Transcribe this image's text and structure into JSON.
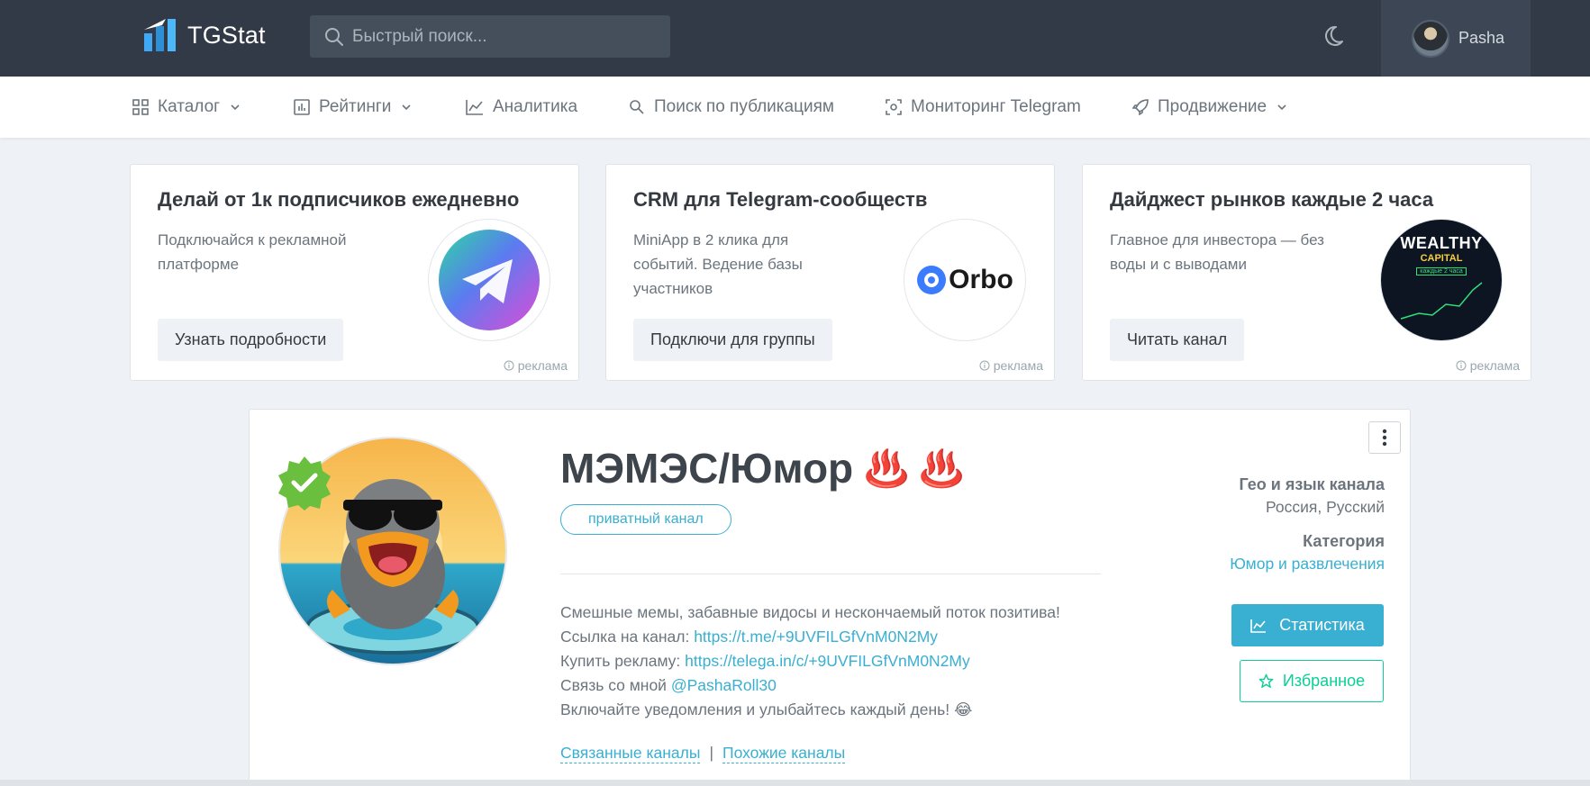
{
  "header": {
    "logo_text": "TGStat",
    "search_placeholder": "Быстрый поиск...",
    "user_name": "Pasha"
  },
  "nav": {
    "items": [
      {
        "label": "Каталог",
        "icon": "grid-icon",
        "dropdown": true
      },
      {
        "label": "Рейтинги",
        "icon": "bar-chart-icon",
        "dropdown": true
      },
      {
        "label": "Аналитика",
        "icon": "line-chart-icon",
        "dropdown": false
      },
      {
        "label": "Поиск по публикациям",
        "icon": "search-doc-icon",
        "dropdown": false
      },
      {
        "label": "Мониторинг Telegram",
        "icon": "scan-icon",
        "dropdown": false
      },
      {
        "label": "Продвижение",
        "icon": "rocket-icon",
        "dropdown": true
      }
    ]
  },
  "ads": [
    {
      "title": "Делай от 1к подписчиков ежедневно",
      "text": "Подключайся к рекламной платформе",
      "button": "Узнать подробности",
      "mark": "реклама",
      "logo": "telegram-logo"
    },
    {
      "title": "CRM для Telegram-сообществ",
      "text": "MiniApp в 2 клика для событий. Ведение базы участников",
      "button": "Подключи для группы",
      "mark": "реклама",
      "logo_text": "Orbo"
    },
    {
      "title": "Дайджест рынков каждые 2 часа",
      "text": "Главное для инвестора — без воды и с выводами",
      "button": "Читать канал",
      "mark": "реклама",
      "logo_text": "WEALTHY",
      "logo_sub": "CAPITAL",
      "logo_tag": "каждые 2 часа"
    }
  ],
  "channel": {
    "title": "МЭМЭС/Юмор",
    "title_emoji": "♨️ ♨️",
    "badge": "приватный канал",
    "description": {
      "line1": "Смешные мемы, забавные видосы и нескончаемый поток позитива!",
      "line2_label": "Ссылка на канал: ",
      "line2_link": "https://t.me/+9UVFILGfVnM0N2My",
      "line3_label": "Купить рекламу: ",
      "line3_link": "https://telega.in/c/+9UVFILGfVnM0N2My",
      "line4_label": "Связь со мной ",
      "line4_link": "@PashaRoll30",
      "line5": "Включайте уведомления и улыбайтесь каждый день! 😂"
    },
    "links": {
      "related": "Связанные каналы",
      "separator": "|",
      "similar": "Похожие каналы"
    },
    "geo_heading": "Гео и язык канала",
    "geo_value": "Россия, Русский",
    "category_heading": "Категория",
    "category_value": "Юмор и развлечения",
    "stats_button": "Статистика",
    "favorite_button": "Избранное"
  },
  "colors": {
    "topbar": "#313a46",
    "accent": "#39afd1",
    "success": "#0acf97",
    "verified": "#6bbf3f"
  }
}
